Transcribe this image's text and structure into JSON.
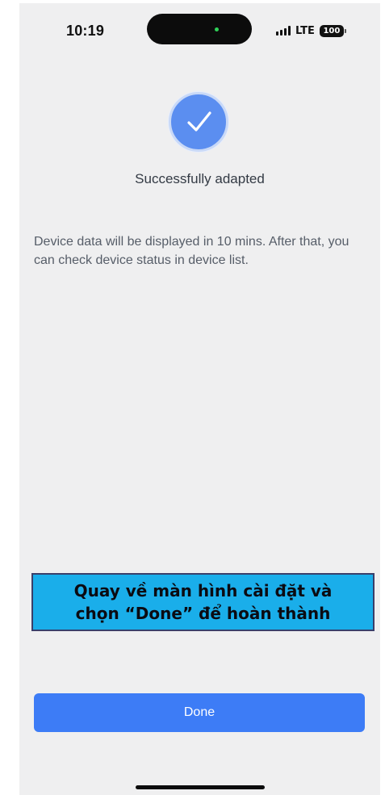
{
  "status_bar": {
    "time": "10:19",
    "network": "LTE",
    "battery": "100",
    "signal_icon": "signal-icon",
    "battery_icon": "battery-icon"
  },
  "success": {
    "icon": "checkmark-circle-icon",
    "title": "Successfully adapted",
    "message": "Device data will be displayed in 10 mins. After that, you can check device status in device list."
  },
  "annotation": {
    "text": "Quay về màn hình cài đặt và\nchọn “Done” để hoàn thành"
  },
  "actions": {
    "done_label": "Done"
  },
  "colors": {
    "accent": "#3d7cf6",
    "check_circle": "#5b8ef0",
    "banner": "#1aaeea",
    "background": "#efeff0"
  }
}
